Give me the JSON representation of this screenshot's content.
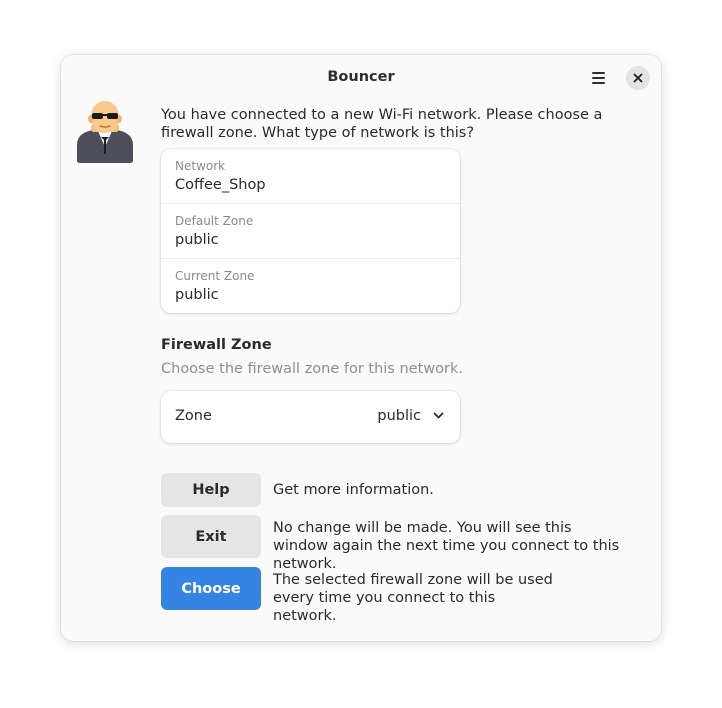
{
  "window": {
    "title": "Bouncer",
    "menu_icon": "hamburger-menu-icon",
    "close_icon": "close-icon"
  },
  "avatar_icon": "bouncer-avatar-icon",
  "intro": "You have connected to a new Wi-Fi network. Please choose a firewall zone. What type of network is this?",
  "info": [
    {
      "label": "Network",
      "value": "Coffee_Shop"
    },
    {
      "label": "Default Zone",
      "value": "public"
    },
    {
      "label": "Current Zone",
      "value": "public"
    }
  ],
  "firewall": {
    "title": "Firewall Zone",
    "subtitle": "Choose the firewall zone for this network.",
    "zone_label": "Zone",
    "zone_value": "public"
  },
  "actions": {
    "help": {
      "label": "Help",
      "description": "Get more information."
    },
    "exit": {
      "label": "Exit",
      "description": "No change will be made. You will see this window again the next time you connect to this network."
    },
    "choose": {
      "label": "Choose",
      "description": "The selected firewall zone will be used every time you connect to this network."
    }
  },
  "colors": {
    "accent": "#3584e4",
    "window_bg": "#fafafa",
    "button_gray": "#e5e5e5"
  }
}
